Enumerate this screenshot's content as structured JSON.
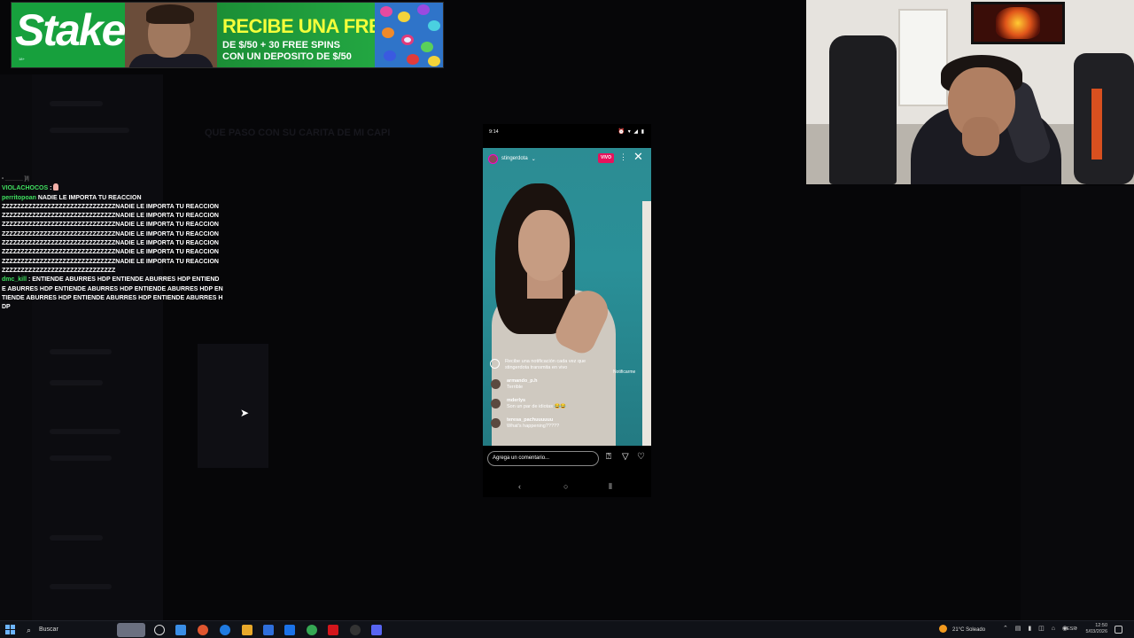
{
  "background": {
    "heading": "QUE PASO CON SU CARITA DE MI CAPI"
  },
  "ad": {
    "brand": "Stake",
    "headline": "RECIBE UNA FREEBET",
    "line1": "DE $/50 + 30 FREE SPINS",
    "line2": "CON UN DEPOSITO DE $/50",
    "fine_print": "18+",
    "colors": {
      "green": "#1c9c3a",
      "yellow": "#f4ff3a"
    }
  },
  "chat": {
    "messages": [
      {
        "user": "VIOLACHOCOS",
        "sep": " :",
        "text": "",
        "emote": true
      },
      {
        "user": "perritopoan",
        "sep": " :",
        "text": " NADIE LE IMPORTA TU REACCION"
      },
      {
        "user": "",
        "sep": "",
        "text": "ZZZZZZZZZZZZZZZZZZZZZZZZZZZZZZNADIE LE IMPORTA TU REACCION"
      },
      {
        "user": "",
        "sep": "",
        "text": "ZZZZZZZZZZZZZZZZZZZZZZZZZZZZZZNADIE LE IMPORTA TU REACCION"
      },
      {
        "user": "",
        "sep": "",
        "text": "ZZZZZZZZZZZZZZZZZZZZZZZZZZZZZZNADIE LE IMPORTA TU REACCION"
      },
      {
        "user": "",
        "sep": "",
        "text": "ZZZZZZZZZZZZZZZZZZZZZZZZZZZZZZNADIE LE IMPORTA TU REACCION"
      },
      {
        "user": "",
        "sep": "",
        "text": "ZZZZZZZZZZZZZZZZZZZZZZZZZZZZZZNADIE LE IMPORTA TU REACCION"
      },
      {
        "user": "",
        "sep": "",
        "text": "ZZZZZZZZZZZZZZZZZZZZZZZZZZZZZZNADIE LE IMPORTA TU REACCION"
      },
      {
        "user": "",
        "sep": "",
        "text": "ZZZZZZZZZZZZZZZZZZZZZZZZZZZZZZNADIE LE IMPORTA TU REACCION"
      },
      {
        "user": "",
        "sep": "",
        "text": "ZZZZZZZZZZZZZZZZZZZZZZZZZZZZZZ"
      },
      {
        "user": "dmc_kill",
        "sep": " :",
        "text": " ENTIENDE ABURRES HDP  ENTIENDE ABURRES HDP  ENTIENDE ABURRES HDP  ENTIENDE ABURRES HDP  ENTIENDE ABURRES HDP  ENTIENDE ABURRES HDP  ENTIENDE ABURRES HDP  ENTIENDE ABURRES HDP"
      }
    ]
  },
  "phone": {
    "status_time": "9:14",
    "status_icons": "⏰ ▾ ◢ ▮",
    "account": "stingerdota",
    "live_badge": "VIVO",
    "notify_text": "Recibe una notificación cada vez que stingerdota transmita en vivo",
    "notify_button": "Notificarme",
    "comments": [
      {
        "user": "armando_p.h",
        "text": "Terrible"
      },
      {
        "user": "mderlys",
        "text": "Son un par de idiotas 😂😂"
      },
      {
        "user": "teresa_pachuuuuuu",
        "text": "What's happening?????"
      }
    ],
    "comment_placeholder": "Agrega un comentario..."
  },
  "taskbar": {
    "search_label": "Buscar",
    "weather": "21°C  Soleado",
    "language": "ESP",
    "time": "12:50",
    "date": "5/03/2026",
    "app_colors": [
      "#3a8ee6",
      "#e8a82a",
      "#1f7ae0",
      "#35a853",
      "#2f6fdc",
      "#1b72e8",
      "#e04a2f",
      "#d3161c",
      "#222",
      "#5865f2"
    ]
  }
}
